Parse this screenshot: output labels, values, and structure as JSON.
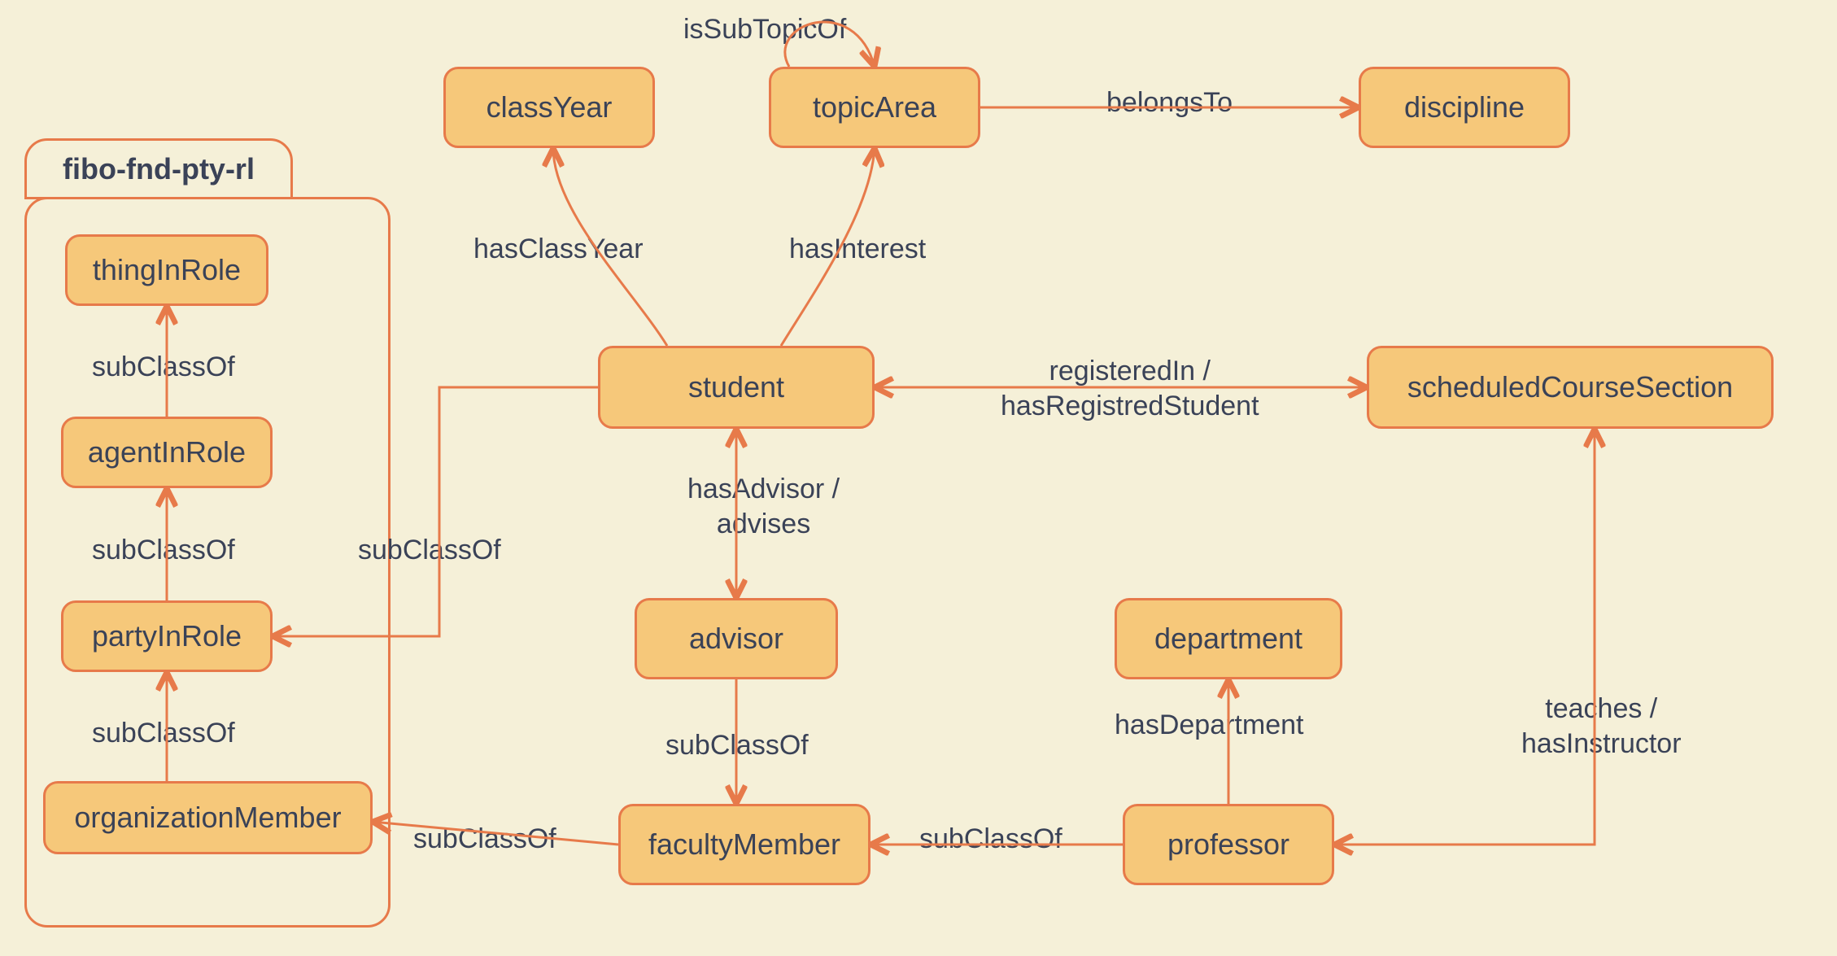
{
  "package": {
    "title": "fibo-fnd-pty-rl"
  },
  "nodes": {
    "thingInRole": "thingInRole",
    "agentInRole": "agentInRole",
    "partyInRole": "partyInRole",
    "organizationMember": "organizationMember",
    "classYear": "classYear",
    "topicArea": "topicArea",
    "discipline": "discipline",
    "student": "student",
    "scheduledCourseSection": "scheduledCourseSection",
    "advisor": "advisor",
    "department": "department",
    "facultyMember": "facultyMember",
    "professor": "professor"
  },
  "edges": {
    "isSubTopicOf": "isSubTopicOf",
    "belongsTo": "belongsTo",
    "hasClassYear": "hasClassYear",
    "hasInterest": "hasInterest",
    "registeredIn": "registeredIn /\nhasRegistredStudent",
    "hasAdvisor": "hasAdvisor /\nadvises",
    "teachesHasInstructor": "teaches /\nhasInstructor",
    "hasDepartment": "hasDepartment",
    "subClassOf1": "subClassOf",
    "subClassOf2": "subClassOf",
    "subClassOf3": "subClassOf",
    "subClassOf4": "subClassOf",
    "subClassOf5": "subClassOf",
    "subClassOf6": "subClassOf",
    "subClassOf7": "subClassOf"
  }
}
